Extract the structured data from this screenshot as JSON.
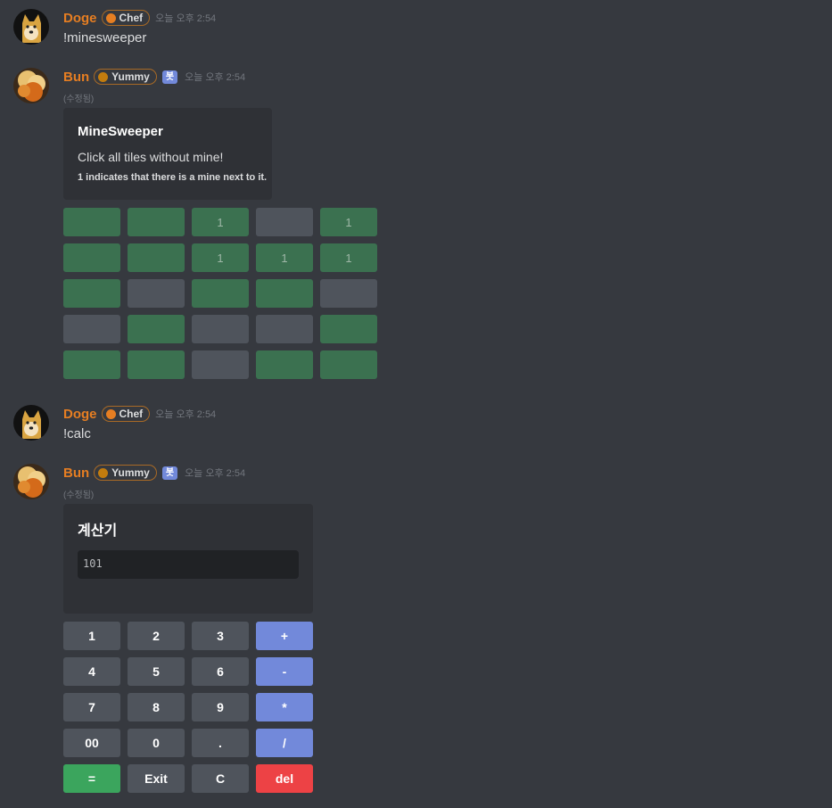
{
  "messages": [
    {
      "user": "Doge",
      "role": "Chef",
      "role_color": "#e67e22",
      "time": "오늘 오후 2:54",
      "text": "!minesweeper"
    },
    {
      "user": "Bun",
      "role": "Yummy",
      "role_color": "#c27c0e",
      "bot": "봇",
      "time": "오늘 오후 2:54",
      "edited": "(수정됨)"
    },
    {
      "user": "Doge",
      "role": "Chef",
      "role_color": "#e67e22",
      "time": "오늘 오후 2:54",
      "text": "!calc"
    },
    {
      "user": "Bun",
      "role": "Yummy",
      "role_color": "#c27c0e",
      "bot": "봇",
      "time": "오늘 오후 2:54",
      "edited": "(수정됨)"
    }
  ],
  "minesweeper": {
    "title": "MineSweeper",
    "description": "Click all tiles without mine!",
    "footer": "1 indicates that there is a mine next to it.",
    "tiles": [
      [
        {
          "s": "g",
          "v": ""
        },
        {
          "s": "g",
          "v": ""
        },
        {
          "s": "g",
          "v": "1"
        },
        {
          "s": "x",
          "v": ""
        },
        {
          "s": "g",
          "v": "1"
        }
      ],
      [
        {
          "s": "g",
          "v": ""
        },
        {
          "s": "g",
          "v": ""
        },
        {
          "s": "g",
          "v": "1"
        },
        {
          "s": "g",
          "v": "1"
        },
        {
          "s": "g",
          "v": "1"
        }
      ],
      [
        {
          "s": "g",
          "v": ""
        },
        {
          "s": "x",
          "v": ""
        },
        {
          "s": "g",
          "v": ""
        },
        {
          "s": "g",
          "v": ""
        },
        {
          "s": "x",
          "v": ""
        }
      ],
      [
        {
          "s": "x",
          "v": ""
        },
        {
          "s": "g",
          "v": ""
        },
        {
          "s": "x",
          "v": ""
        },
        {
          "s": "x",
          "v": ""
        },
        {
          "s": "g",
          "v": ""
        }
      ],
      [
        {
          "s": "g",
          "v": ""
        },
        {
          "s": "g",
          "v": ""
        },
        {
          "s": "x",
          "v": ""
        },
        {
          "s": "g",
          "v": ""
        },
        {
          "s": "g",
          "v": ""
        }
      ]
    ]
  },
  "calculator": {
    "title": "계산기",
    "display": "101",
    "buttons": [
      [
        {
          "l": "1",
          "c": "grey"
        },
        {
          "l": "2",
          "c": "grey"
        },
        {
          "l": "3",
          "c": "grey"
        },
        {
          "l": "+",
          "c": "blue"
        }
      ],
      [
        {
          "l": "4",
          "c": "grey"
        },
        {
          "l": "5",
          "c": "grey"
        },
        {
          "l": "6",
          "c": "grey"
        },
        {
          "l": "-",
          "c": "blue"
        }
      ],
      [
        {
          "l": "7",
          "c": "grey"
        },
        {
          "l": "8",
          "c": "grey"
        },
        {
          "l": "9",
          "c": "grey"
        },
        {
          "l": "*",
          "c": "blue"
        }
      ],
      [
        {
          "l": "00",
          "c": "grey"
        },
        {
          "l": "0",
          "c": "grey"
        },
        {
          "l": ".",
          "c": "grey"
        },
        {
          "l": "/",
          "c": "blue"
        }
      ],
      [
        {
          "l": "=",
          "c": "green"
        },
        {
          "l": "Exit",
          "c": "grey"
        },
        {
          "l": "C",
          "c": "grey"
        },
        {
          "l": "del",
          "c": "red"
        }
      ]
    ]
  },
  "colors": {
    "background": "#36393f",
    "embed": "#2f3136",
    "username": "#e67e22",
    "blurple": "#7289da"
  }
}
